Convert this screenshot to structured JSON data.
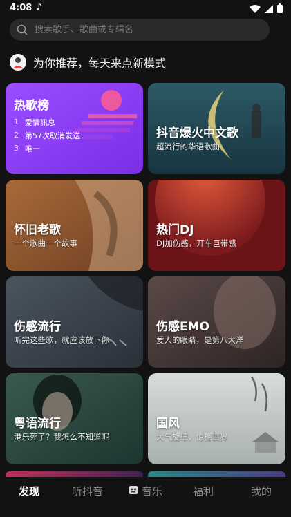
{
  "status": {
    "time": "4:08",
    "note_icon": "music-note-icon"
  },
  "search": {
    "placeholder": "搜索歌手、歌曲或专辑名"
  },
  "recommend": {
    "title": "为你推荐，每天来点新模式"
  },
  "hot": {
    "title": "热歌榜",
    "items": [
      {
        "rank": "1",
        "name": "爱情訊息"
      },
      {
        "rank": "2",
        "name": "第57次取消发送"
      },
      {
        "rank": "3",
        "name": "唯一"
      }
    ]
  },
  "cards": [
    {
      "title": "抖音爆火中文歌",
      "subtitle": "超流行的华语歌曲"
    },
    {
      "title": "怀旧老歌",
      "subtitle": "一个歌曲一个故事"
    },
    {
      "title": "热门DJ",
      "subtitle": "DJ加伤感，开车巨带感"
    },
    {
      "title": "伤感流行",
      "subtitle": "听完这些歌，就应该放下你"
    },
    {
      "title": "伤感EMO",
      "subtitle": "爱人的眼睛，是第八大洋"
    },
    {
      "title": "粤语流行",
      "subtitle": "港乐死了？我怎么不知道呢"
    },
    {
      "title": "国风",
      "subtitle": "大气旋律，惊艳世界"
    }
  ],
  "tabs": [
    {
      "label": "发现",
      "active": true
    },
    {
      "label": "听抖音"
    },
    {
      "label": "音乐"
    },
    {
      "label": "福利"
    },
    {
      "label": "我的"
    }
  ],
  "colors": {
    "accent_purple": "#8a3cf0",
    "background": "#121212"
  }
}
